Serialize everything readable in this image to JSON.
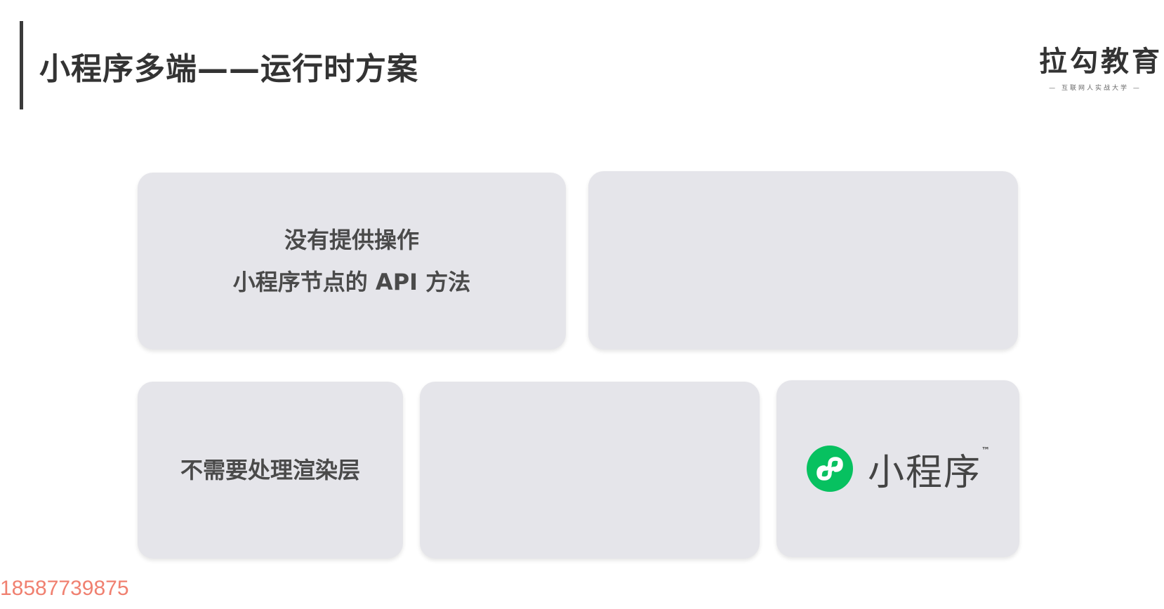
{
  "header": {
    "title": "小程序多端——运行时方案",
    "logo_main": "拉勾教育",
    "logo_sub": "— 互联网人实战大学 —"
  },
  "cards": {
    "api_note_line1": "没有提供操作",
    "api_note_line2": "小程序节点的 API 方法",
    "render_note": "不需要处理渲染层",
    "brand_name": "小程序",
    "brand_tm": "™"
  },
  "watermark": "18587739875",
  "colors": {
    "card_bg": "#e5e5ea",
    "brand_green": "#07c160",
    "watermark": "#f08070"
  }
}
